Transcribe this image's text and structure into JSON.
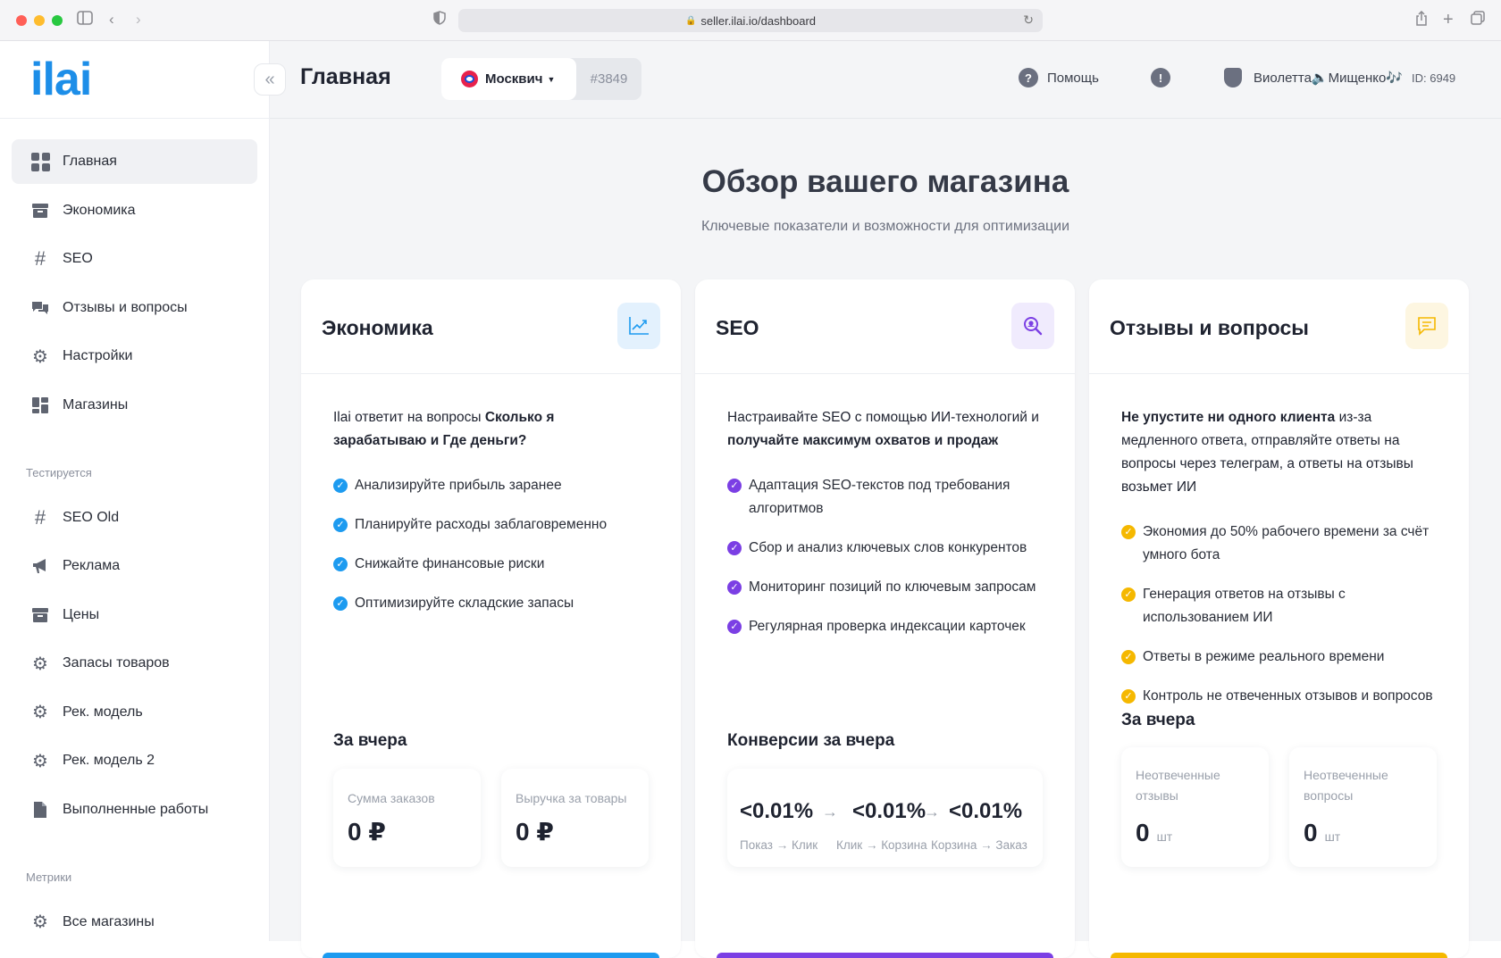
{
  "browser": {
    "url": "seller.ilai.io/dashboard"
  },
  "sidebar": {
    "logo": "ilai",
    "items": [
      {
        "label": "Главная",
        "icon": "dashboard-icon",
        "active": true
      },
      {
        "label": "Экономика",
        "icon": "archive-icon"
      },
      {
        "label": "SEO",
        "icon": "hash-icon"
      },
      {
        "label": "Отзывы и вопросы",
        "icon": "chat-icon"
      },
      {
        "label": "Настройки",
        "icon": "gear-icon"
      },
      {
        "label": "Магазины",
        "icon": "store-grid-icon"
      }
    ],
    "testing_section": "Тестируется",
    "testing_items": [
      {
        "label": "SEO Old",
        "icon": "hash-icon"
      },
      {
        "label": "Реклама",
        "icon": "megaphone-icon"
      },
      {
        "label": "Цены",
        "icon": "archive-icon"
      },
      {
        "label": "Запасы товаров",
        "icon": "gear-icon"
      },
      {
        "label": "Рек. модель",
        "icon": "gear-icon"
      },
      {
        "label": "Рек. модель 2",
        "icon": "gear-icon"
      },
      {
        "label": "Выполненные работы",
        "icon": "document-icon"
      }
    ],
    "metrics_section": "Метрики",
    "metrics_items": [
      {
        "label": "Все магазины",
        "icon": "gear-icon"
      }
    ]
  },
  "header": {
    "title": "Главная",
    "store_name": "Москвич",
    "store_id": "#3849",
    "help": "Помощь",
    "user_name": "Виолетта🔈Мищенко🎶",
    "user_id": "ID: 6949"
  },
  "hero": {
    "title": "Обзор вашего магазина",
    "subtitle": "Ключевые показатели и возможности для оптимизации"
  },
  "colors": {
    "blue": "#1d9bf0",
    "purple": "#7b3fe4",
    "yellow": "#f5b800"
  },
  "cards": {
    "economics": {
      "title": "Экономика",
      "intro_a": "Ilai ответит на вопросы ",
      "intro_b": "Сколько я зарабатываю и Где деньги?",
      "bullets": [
        "Анализируйте прибыль заранее",
        "Планируйте расходы заблаговременно",
        "Снижайте финансовые риски",
        "Оптимизируйте складские запасы"
      ],
      "section": "За вчера",
      "stat1_label": "Сумма заказов",
      "stat1_value": "0 ₽",
      "stat2_label": "Выручка за товары",
      "stat2_value": "0 ₽"
    },
    "seo": {
      "title": "SEO",
      "intro_a": "Настраивайте SEO с помощью ИИ-технологий и ",
      "intro_b": "получайте максимум охватов и продаж",
      "bullets": [
        "Адаптация SEO-текстов под требования алгоритмов",
        "Сбор и анализ ключевых слов конкурентов",
        "Мониторинг позиций по ключевым запросам",
        "Регулярная проверка индексации карточек"
      ],
      "section": "Конверсии за вчера",
      "conv": [
        {
          "value": "<0.01%",
          "label": "Показ → Клик"
        },
        {
          "value": "<0.01%",
          "label": "Клик → Корзина"
        },
        {
          "value": "<0.01%",
          "label": "Корзина → Заказ"
        }
      ],
      "arrow": "→"
    },
    "reviews": {
      "title": "Отзывы и вопросы",
      "intro_a": "Не упустите ни одного клиента",
      "intro_b": " из-за медленного ответа, отправляйте ответы на вопросы через телеграм, а ответы на отзывы возьмет ИИ",
      "bullets": [
        "Экономия до 50% рабочего времени за счёт умного бота",
        "Генерация ответов на отзывы с использованием ИИ",
        "Ответы в режиме реального времени",
        "Контроль не отвеченных отзывов и вопросов"
      ],
      "section": "За вчера",
      "stat1_label": "Неотвеченные отзывы",
      "stat1_value": "0",
      "stat2_label": "Неотвеченные вопросы",
      "stat2_value": "0",
      "unit": "шт"
    }
  }
}
